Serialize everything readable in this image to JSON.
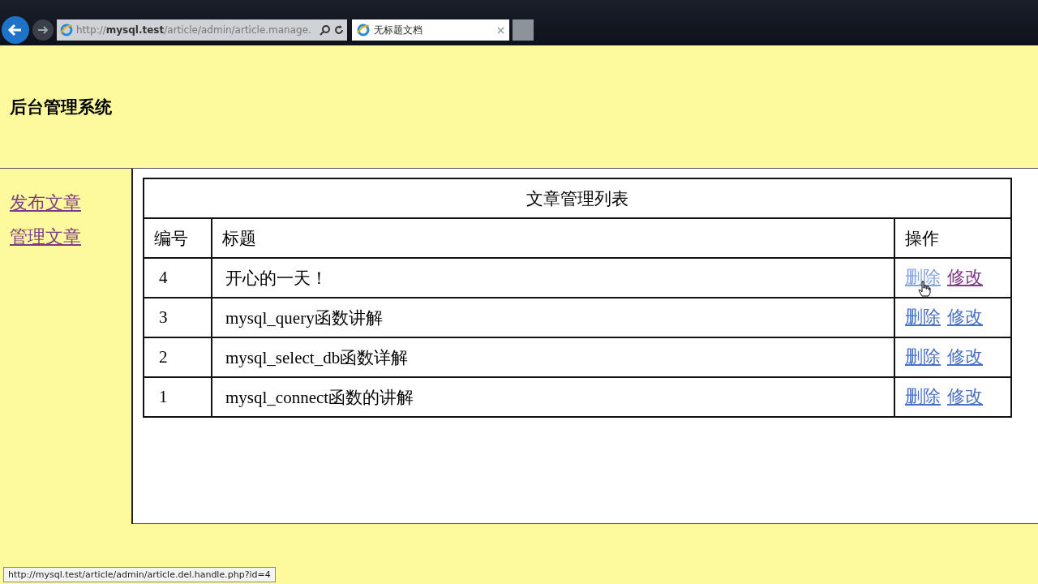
{
  "browser": {
    "back_enabled": true,
    "forward_enabled": false,
    "address": {
      "prefix": "http://",
      "host": "mysql.test",
      "path": "/article/admin/article.manage."
    },
    "tabs": [
      {
        "title": "无标题文档",
        "selected": true
      }
    ]
  },
  "header": {
    "title": "后台管理系统"
  },
  "sidebar": {
    "items": [
      {
        "label": "发布文章",
        "visited": true
      },
      {
        "label": "管理文章",
        "visited": true
      }
    ]
  },
  "table": {
    "caption": "文章管理列表",
    "columns": [
      "编号",
      "标题",
      "操作"
    ],
    "rows": [
      {
        "id": "4",
        "title": "开心的一天！",
        "actions": [
          {
            "label": "删除",
            "visited": false,
            "hovered": true
          },
          {
            "label": "修改",
            "visited": true,
            "hovered": false
          }
        ]
      },
      {
        "id": "3",
        "title": "mysql_query函数讲解",
        "actions": [
          {
            "label": "删除",
            "visited": false,
            "hovered": false
          },
          {
            "label": "修改",
            "visited": false,
            "hovered": false
          }
        ]
      },
      {
        "id": "2",
        "title": "mysql_select_db函数详解",
        "actions": [
          {
            "label": "删除",
            "visited": false,
            "hovered": false
          },
          {
            "label": "修改",
            "visited": false,
            "hovered": false
          }
        ]
      },
      {
        "id": "1",
        "title": "mysql_connect函数的讲解",
        "actions": [
          {
            "label": "删除",
            "visited": false,
            "hovered": false
          },
          {
            "label": "修改",
            "visited": false,
            "hovered": false
          }
        ]
      }
    ]
  },
  "status_bar": {
    "url": "http://mysql.test/article/admin/article.del.handle.php?id=4"
  }
}
